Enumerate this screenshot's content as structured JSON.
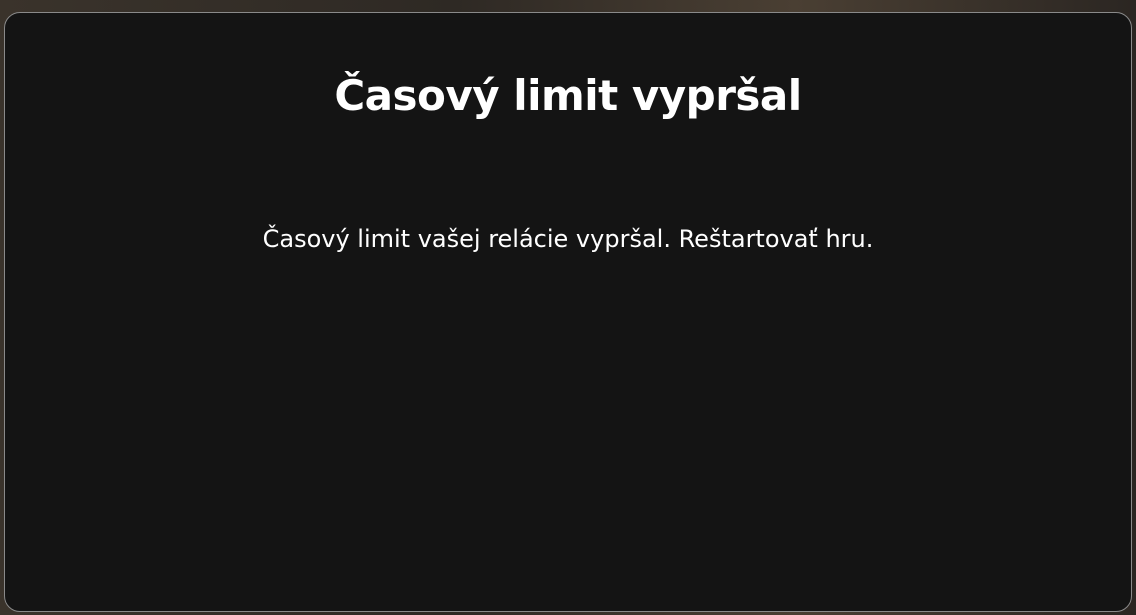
{
  "dialog": {
    "title": "Časový limit vypršal",
    "message": "Časový limit vašej relácie vypršal. Reštartovať hru."
  },
  "colors": {
    "dialog_background": "#141414",
    "dialog_border": "#8a8a8a",
    "text": "#ffffff"
  }
}
